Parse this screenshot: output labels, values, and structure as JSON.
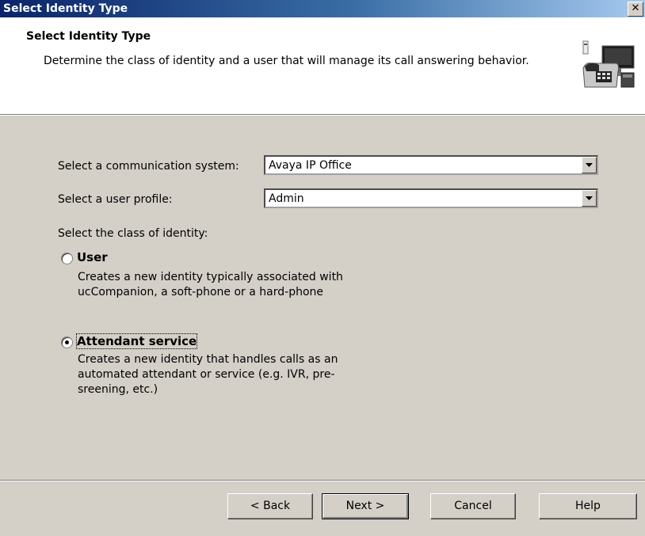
{
  "window": {
    "title": "Select Identity Type",
    "close_label": "✕"
  },
  "header": {
    "title": "Select Identity Type",
    "description": "Determine the class of identity and a user that will manage its call answering behavior."
  },
  "form": {
    "communication_system": {
      "label": "Select a communication system:",
      "value": "Avaya IP Office"
    },
    "user_profile": {
      "label": "Select a user profile:",
      "value": "Admin"
    },
    "class_label": "Select the class of identity:",
    "options": [
      {
        "label": "User",
        "description": "Creates a new identity typically associated with ucCompanion, a soft-phone or a hard-phone",
        "selected": false
      },
      {
        "label": "Attendant service",
        "description": "Creates a new identity that handles calls as an automated attendant or service (e.g. IVR, pre-sreening, etc.)",
        "selected": true
      }
    ]
  },
  "buttons": {
    "back": "< Back",
    "next": "Next >",
    "cancel": "Cancel",
    "help": "Help"
  },
  "colors": {
    "title_bar_start": "#0a246a",
    "title_bar_end": "#a6caf0",
    "dialog_face": "#d4d0c8"
  },
  "icons": {
    "header": "phone-computer-icon",
    "close": "close-icon",
    "dropdown": "chevron-down-icon"
  }
}
